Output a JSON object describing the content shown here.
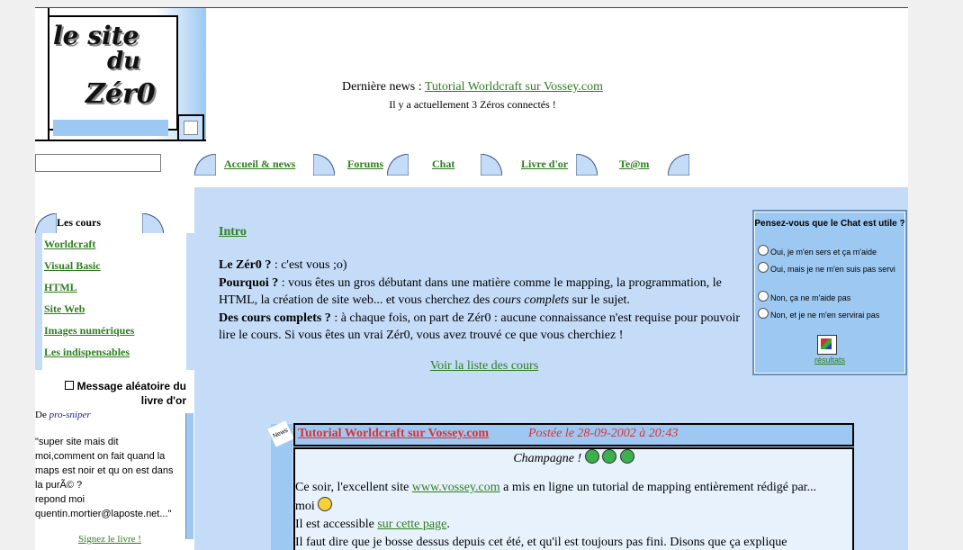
{
  "header": {
    "logo": {
      "line1": "le site",
      "line2": "du",
      "line3": "Zér0"
    },
    "news_label": "Dernière news : ",
    "news_link": "Tutorial Worldcraft sur Vossey.com",
    "connected": "Il y a actuellement 3 Zéros connectés !"
  },
  "search": {
    "value": ""
  },
  "nav": {
    "tabs": [
      "Accueil & news",
      "Forums",
      "Chat",
      "Livre d'or",
      "Te@m"
    ]
  },
  "sidebar": {
    "title": "Les cours",
    "items": [
      "Worldcraft",
      "Visual Basic",
      "HTML",
      "Site Web",
      "Images numériques",
      "Les indispensables"
    ]
  },
  "message": {
    "title": "Message aléatoire du livre d'or",
    "from_label": "De ",
    "author": "pro-sniper",
    "lines": [
      "\"super site mais dit",
      "moi,comment on fait quand la",
      "maps est noir et qu on est dans",
      "la purÃ© ?",
      "repond moi",
      "quentin.mortier@laposte.net...\""
    ],
    "sign_link": "Signez le livre !"
  },
  "intro": {
    "heading": "Intro",
    "p1_bold": "Le Zér0 ?",
    "p1_text": " : c'est vous ;o)",
    "p2_bold": "Pourquoi ?",
    "p2_text1": " : vous êtes un gros débutant dans une matière comme le mapping, la programmation, le HTML, la création de site web... et vous cherchez des ",
    "p2_em": "cours complets",
    "p2_text2": " sur le sujet.",
    "p3_bold": "Des cours complets ?",
    "p3_text": " : à chaque fois, on part de Zér0 : aucune connaissance n'est requise pour pouvoir lire le cours. Si vous êtes un vrai Zér0, vous avez trouvé ce que vous cherchiez !",
    "link": "Voir la liste des cours"
  },
  "poll": {
    "question": "Pensez-vous que le Chat est utile ?",
    "options": [
      "Oui, je m'en sers et ça m'aide",
      "Oui, mais je ne m'en suis pas servi",
      "Non, ça ne m'aide pas",
      "Non, et je ne m'en servirai pas"
    ],
    "results": "résultats"
  },
  "news": {
    "tag": "News",
    "title": "Tutorial Worldcraft sur Vossey.com",
    "date": "Postée le 28-09-2002 à 20:43",
    "subtitle": "Champagne !",
    "line1_a": "Ce soir, l'excellent site ",
    "line1_link": "www.vossey.com",
    "line1_b": " a mis en ligne un tutorial de mapping entièrement rédigé par...",
    "line2": "moi",
    "line3_a": "Il est accessible ",
    "line3_link": "sur cette page",
    "line3_b": ".",
    "line4": "Il faut dire que je bosse dessus depuis cet été, et qu'il est toujours pas fini. Disons que ça explique"
  },
  "colors": {
    "accent_blue": "#c4dcf8",
    "link_green": "#2e7d1f",
    "news_red": "#e03030"
  }
}
